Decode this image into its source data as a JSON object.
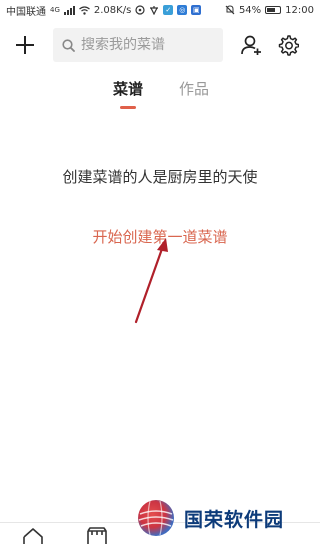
{
  "status_bar": {
    "carrier": "中国联通",
    "network": "4G",
    "speed": "2.08K/s",
    "battery": "54%",
    "time": "12:00"
  },
  "top_bar": {
    "search_placeholder": "搜索我的菜谱"
  },
  "tabs": [
    {
      "label": "菜谱",
      "active": true
    },
    {
      "label": "作品",
      "active": false
    }
  ],
  "main": {
    "empty_text": "创建菜谱的人是厨房里的天使",
    "create_link": "开始创建第一道菜谱"
  },
  "watermark": {
    "text": "国荣软件园"
  },
  "colors": {
    "accent": "#d9664f",
    "annotation_arrow": "#b0202a",
    "watermark": "#0d3b7a"
  },
  "icons": [
    "add-icon",
    "search-icon",
    "add-friend-icon",
    "gear-icon",
    "home-icon",
    "store-icon"
  ]
}
